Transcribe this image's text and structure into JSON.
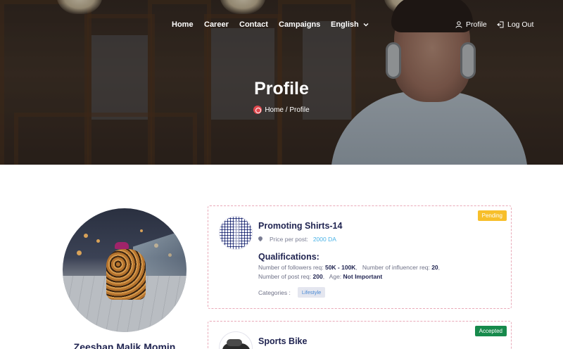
{
  "nav": {
    "items": [
      "Home",
      "Career",
      "Contact",
      "Campaigns",
      "English"
    ],
    "profile_label": "Profile",
    "logout_label": "Log Out"
  },
  "hero": {
    "title": "Profile",
    "breadcrumb": "Home / Profile"
  },
  "user": {
    "name": "Zeeshan Malik Momin"
  },
  "campaigns": [
    {
      "status": "Pending",
      "title": "Promoting Shirts-14",
      "price_label": "Price per post:",
      "price_value": "2000 DA",
      "qualifications_title": "Qualifications:",
      "followers_label": "Number of followers req:",
      "followers_value": "50K - 100K",
      "influencer_label": "Number of influencer req:",
      "influencer_value": "20",
      "posts_label": "Number of post req:",
      "posts_value": "200",
      "age_label": "Age:",
      "age_value": "Not Important",
      "categories_label": "Categories :",
      "category": "Lifestyle"
    },
    {
      "status": "Accepted",
      "title": "Sports Bike"
    }
  ],
  "colors": {
    "pending": "#f7bf2b",
    "accepted": "#178a4c",
    "title": "#1f2350",
    "price": "#4bb3e6",
    "card_border": "#e9a9b8"
  },
  "icons": [
    "user-icon",
    "logout-icon",
    "chevron-down-icon",
    "location-pin-icon",
    "brand-logo-icon"
  ]
}
